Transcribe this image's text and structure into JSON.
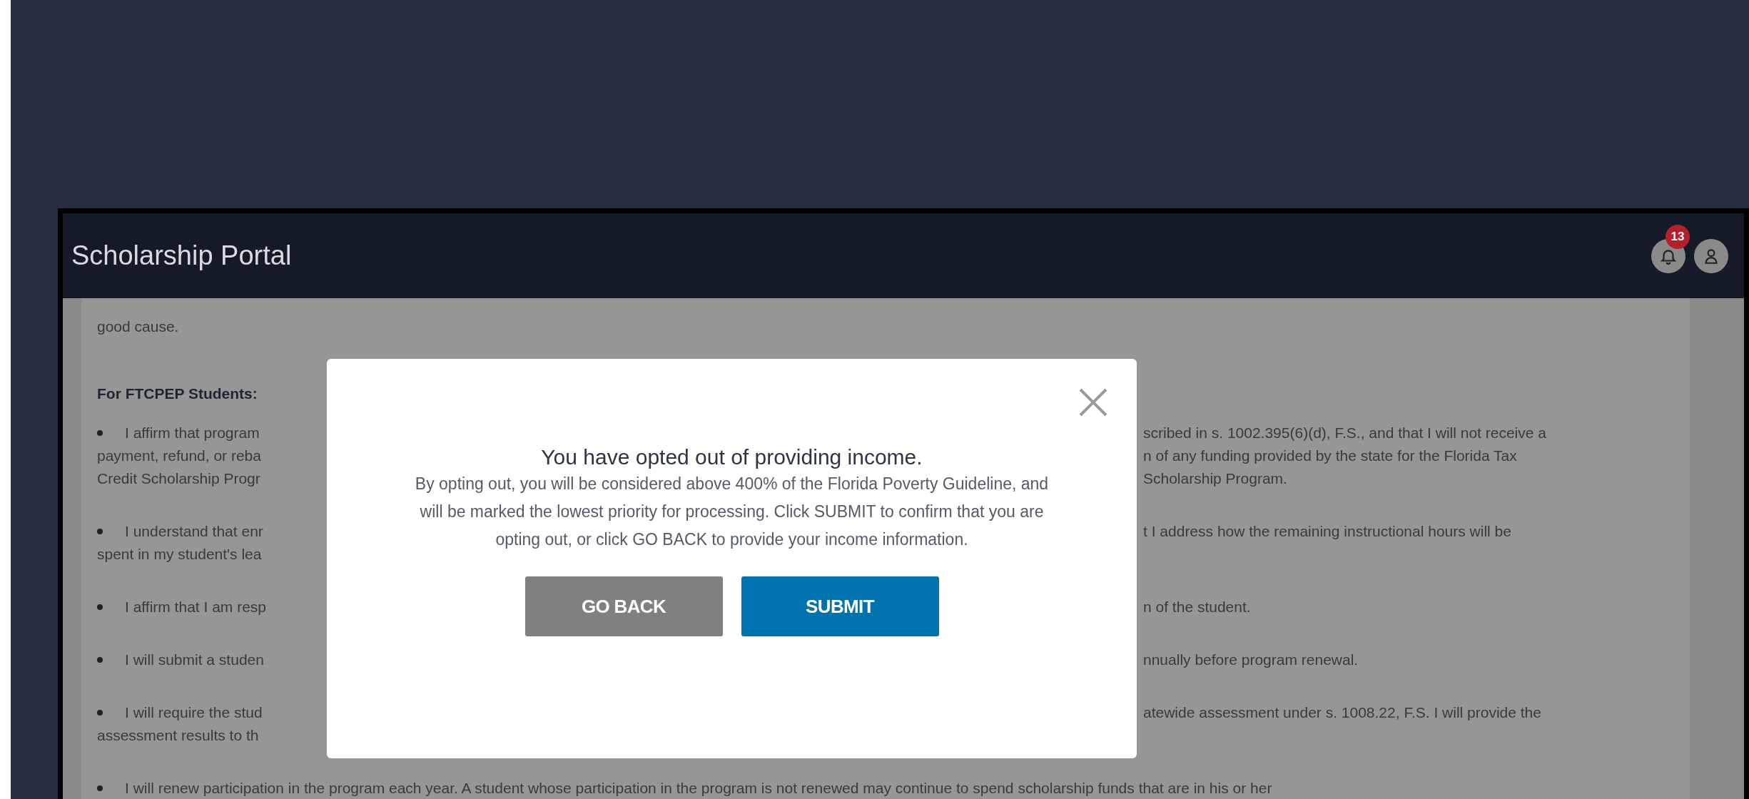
{
  "header": {
    "title": "Scholarship Portal",
    "notification_count": "13"
  },
  "content": {
    "blocks": [
      {
        "kind": "text",
        "lines": [
          {
            "left": "good cause."
          }
        ]
      },
      {
        "kind": "heading",
        "lines": [
          {
            "left": "For FTCPEP Students:"
          }
        ]
      },
      {
        "kind": "bullet",
        "lines": [
          {
            "left": "I affirm that program",
            "right": "scribed in s. 1002.395(6)(d), F.S., and that I will not receive a"
          },
          {
            "left": "payment, refund, or reba",
            "right": "n of any funding provided by the state for the Florida Tax"
          },
          {
            "left": "Credit Scholarship Progr",
            "right": "Scholarship Program."
          }
        ]
      },
      {
        "kind": "bullet",
        "lines": [
          {
            "left": "I understand that enr",
            "right": "t I address how the remaining instructional hours will be"
          },
          {
            "left": "spent in my student's lea"
          }
        ]
      },
      {
        "kind": "bullet",
        "lines": [
          {
            "left": "I affirm that I am resp",
            "right": "n of the student."
          }
        ]
      },
      {
        "kind": "bullet",
        "lines": [
          {
            "left": "I will submit a studen",
            "right": "nnually before program renewal."
          }
        ]
      },
      {
        "kind": "bullet",
        "lines": [
          {
            "left": "I will require the stud",
            "right": "atewide assessment under s. 1008.22, F.S. I will provide the"
          },
          {
            "left": "assessment results to th"
          }
        ]
      },
      {
        "kind": "bullet",
        "lines": [
          {
            "full": "I will renew participation in the program each year. A student whose participation in the program is not renewed may continue to spend scholarship funds that are in his or her"
          }
        ]
      }
    ]
  },
  "dialog": {
    "title": "You have opted out of providing income.",
    "message": "By opting out, you will be considered above 400% of the Florida Poverty Guideline, and will be marked the lowest priority for processing. Click SUBMIT to confirm that you are opting out, or click GO BACK to provide your income information.",
    "buttons": [
      {
        "label": "GO BACK",
        "kind": "secondary"
      },
      {
        "label": "SUBMIT",
        "kind": "primary"
      }
    ]
  }
}
